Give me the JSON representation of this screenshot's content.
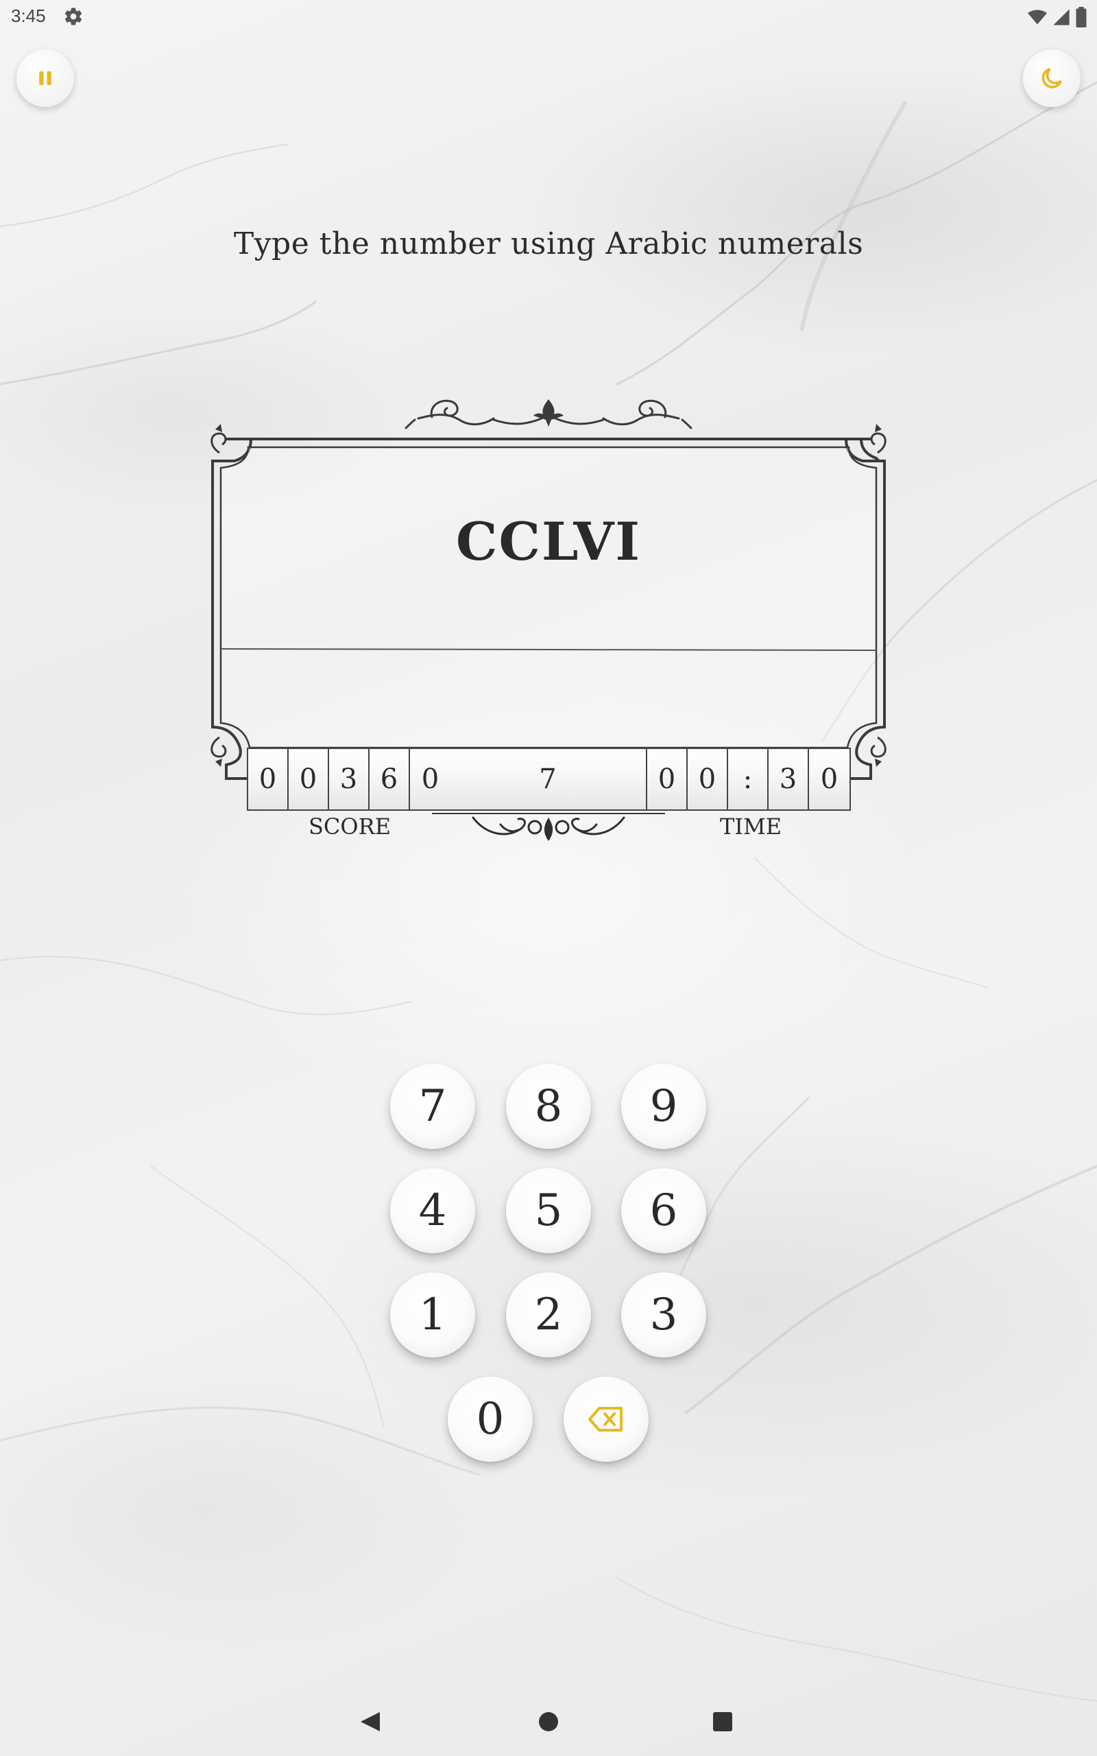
{
  "status_bar": {
    "time": "3:45",
    "icons": [
      "gear-icon",
      "wifi-icon",
      "signal-icon",
      "battery-icon"
    ]
  },
  "top_buttons": {
    "pause_icon": "pause-icon",
    "theme_icon": "moon-icon",
    "accent_color": "#E8B820"
  },
  "game": {
    "instruction": "Type the number using Arabic numerals",
    "roman_numeral": "CCLVI",
    "answer_value": "",
    "score_digits": [
      "0",
      "0",
      "3",
      "6",
      "0"
    ],
    "level": "7",
    "time_digits": [
      "0",
      "0",
      ":",
      "3",
      "0"
    ],
    "score_label": "SCORE",
    "time_label": "TIME"
  },
  "keypad": {
    "keys": [
      "7",
      "8",
      "9",
      "4",
      "5",
      "6",
      "1",
      "2",
      "3",
      "0"
    ],
    "backspace_icon": "backspace-icon"
  },
  "nav_bar": {
    "icons": [
      "back-icon",
      "home-icon",
      "recents-icon"
    ]
  }
}
